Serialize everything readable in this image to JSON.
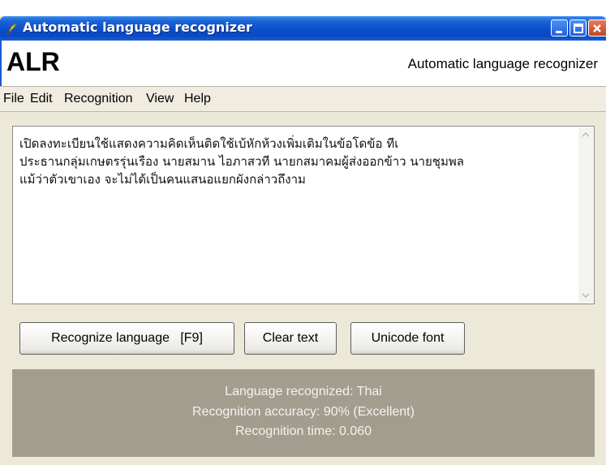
{
  "window": {
    "title": "Automatic language recognizer",
    "icon": "app-icon"
  },
  "header": {
    "app_name": "ALR",
    "subtitle": "Automatic language recognizer"
  },
  "menu": {
    "items": [
      "File",
      "Edit",
      "Recognition",
      "View",
      "Help"
    ]
  },
  "input": {
    "text": "เปิดลงทะเบียนใช้แสดงความคิดเห็นติดใช้เบ้หักห้วงเพิ่มเติมในข้อโดข้อ ทีเ\nประธานกลุ่มเกษตรรุ่นเรือง นายสมาน ไอภาสวที นายกสมาคมผู้ส่งออกข้าว นายชุมพล\nแม้ว่าตัวเขาเอง จะไม่ได้เป็นคนแสนอแยกผังกล่าวถึงาม"
  },
  "buttons": {
    "recognize": "Recognize language   [F9]",
    "clear": "Clear text",
    "unicode": "Unicode font"
  },
  "result": {
    "language": "Language recognized: Thai",
    "accuracy": "Recognition accuracy: 90% (Excellent)",
    "time": "Recognition time: 0.060"
  },
  "colors": {
    "titlebar": "#0a4ecb",
    "result_panel": "#a39d8e",
    "result_text": "#f4f2ec"
  }
}
